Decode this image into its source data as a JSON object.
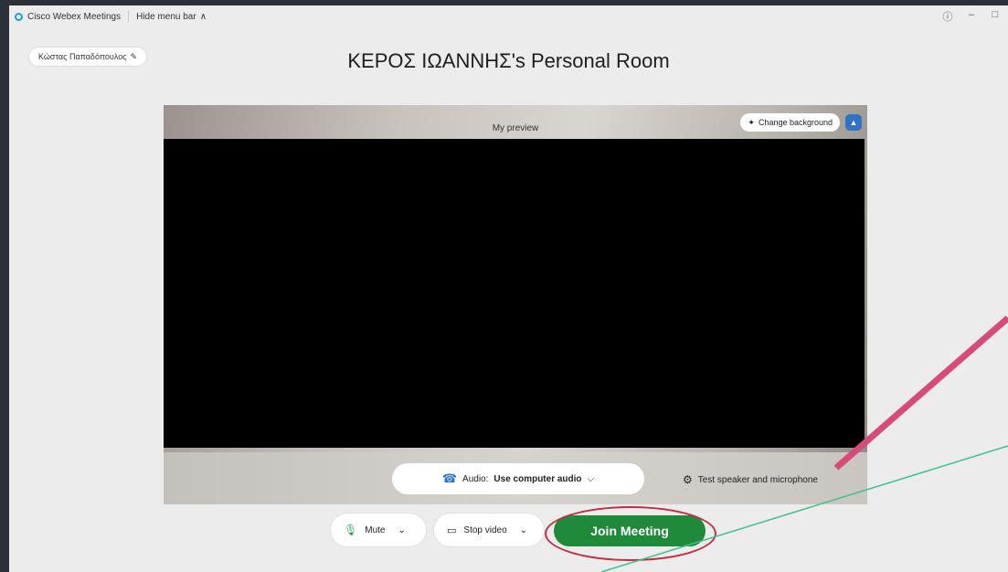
{
  "window": {
    "app_title": "Cisco Webex Meetings",
    "hide_menu_label": "Hide menu bar",
    "hide_menu_icon": "chevron-up-icon",
    "controls": [
      "help-icon",
      "minimize-icon",
      "maximize-icon"
    ]
  },
  "user": {
    "name": "Κώστας Παπαδόπουλος",
    "edit_icon": "pencil-icon"
  },
  "room": {
    "title": "ΚΕΡΟΣ ΙΩΑΝΝΗΣ's Personal Room"
  },
  "preview": {
    "label": "My preview",
    "change_background_label": "Change background",
    "expand_icon": "chevron-up-icon"
  },
  "audio": {
    "prefix": "Audio:",
    "value": "Use computer audio",
    "test_label": "Test speaker and microphone"
  },
  "controls": {
    "mute_label": "Mute",
    "stop_video_label": "Stop video",
    "join_label": "Join Meeting"
  },
  "colors": {
    "join_green": "#1e8a3a",
    "annotation_pink": "#d64b7a",
    "annotation_green": "#3fc08a",
    "highlight_red": "#c22d3f"
  }
}
